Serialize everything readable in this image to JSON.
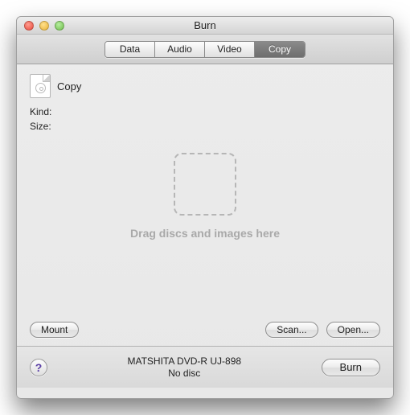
{
  "window": {
    "title": "Burn"
  },
  "tabs": {
    "data": "Data",
    "audio": "Audio",
    "video": "Video",
    "copy": "Copy",
    "active": "copy"
  },
  "copy": {
    "title": "Copy",
    "kind_label": "Kind:",
    "kind_value": "",
    "size_label": "Size:",
    "size_value": ""
  },
  "dropzone": {
    "hint": "Drag discs and images here"
  },
  "buttons": {
    "mount": "Mount",
    "scan": "Scan...",
    "open": "Open...",
    "burn": "Burn"
  },
  "status": {
    "device": "MATSHITA DVD-R UJ-898",
    "disc": "No disc"
  }
}
